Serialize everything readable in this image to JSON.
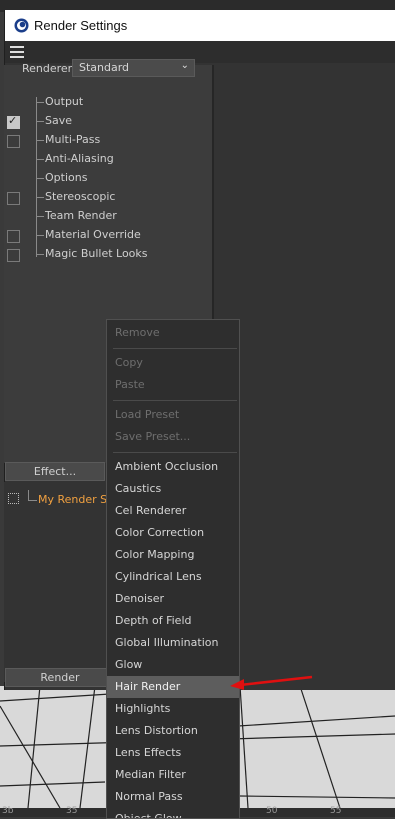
{
  "window": {
    "title": "Render Settings"
  },
  "renderer": {
    "label": "Renderer",
    "value": "Standard"
  },
  "tree": [
    {
      "label": "Output",
      "checkbox": false,
      "checked": false
    },
    {
      "label": "Save",
      "checkbox": true,
      "checked": true
    },
    {
      "label": "Multi-Pass",
      "checkbox": true,
      "checked": false
    },
    {
      "label": "Anti-Aliasing",
      "checkbox": false,
      "checked": false
    },
    {
      "label": "Options",
      "checkbox": false,
      "checked": false
    },
    {
      "label": "Stereoscopic",
      "checkbox": true,
      "checked": false
    },
    {
      "label": "Team Render",
      "checkbox": false,
      "checked": false
    },
    {
      "label": "Material Override",
      "checkbox": true,
      "checked": false
    },
    {
      "label": "Magic Bullet Looks",
      "checkbox": true,
      "checked": false
    }
  ],
  "effect_button": "Effect...",
  "render_settings_item": "My Render Set",
  "render_button": "Render",
  "context_menu": {
    "items": [
      {
        "label": "Remove",
        "enabled": false
      },
      {
        "sep": true
      },
      {
        "label": "Copy",
        "enabled": false
      },
      {
        "label": "Paste",
        "enabled": false
      },
      {
        "sep": true
      },
      {
        "label": "Load Preset",
        "enabled": false
      },
      {
        "label": "Save Preset...",
        "enabled": false
      },
      {
        "sep": true
      },
      {
        "label": "Ambient Occlusion",
        "enabled": true
      },
      {
        "label": "Caustics",
        "enabled": true
      },
      {
        "label": "Cel Renderer",
        "enabled": true
      },
      {
        "label": "Color Correction",
        "enabled": true
      },
      {
        "label": "Color Mapping",
        "enabled": true
      },
      {
        "label": "Cylindrical Lens",
        "enabled": true
      },
      {
        "label": "Denoiser",
        "enabled": true
      },
      {
        "label": "Depth of Field",
        "enabled": true
      },
      {
        "label": "Global Illumination",
        "enabled": true
      },
      {
        "label": "Glow",
        "enabled": true
      },
      {
        "label": "Hair Render",
        "enabled": true,
        "highlighted": true
      },
      {
        "label": "Highlights",
        "enabled": true
      },
      {
        "label": "Lens Distortion",
        "enabled": true
      },
      {
        "label": "Lens Effects",
        "enabled": true
      },
      {
        "label": "Median Filter",
        "enabled": true
      },
      {
        "label": "Normal Pass",
        "enabled": true
      },
      {
        "label": "Object Glow",
        "enabled": true
      }
    ]
  },
  "ruler": [
    "3b",
    "35",
    "50",
    "55"
  ],
  "colors": {
    "highlight": "#5d5d5d",
    "arrow": "#e01010",
    "active_item": "#f0a040"
  }
}
